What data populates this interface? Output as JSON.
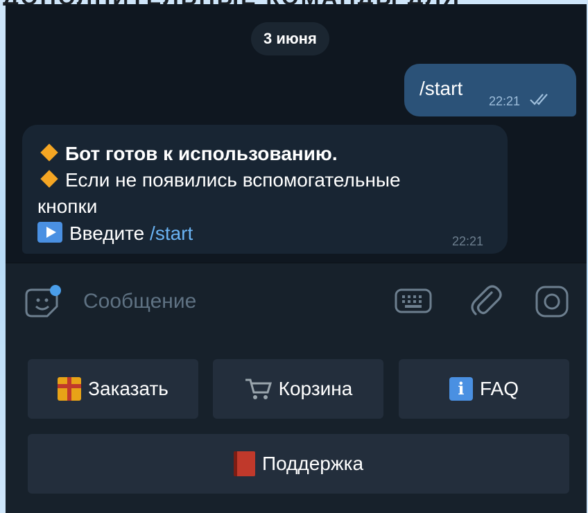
{
  "top_banner": "ДОПОЛНИТЕЛЬНЫЕ КОМАНДЫ ДЛЯ",
  "chat": {
    "date_separator": "3 июня",
    "outgoing": {
      "text": "/start",
      "time": "22:21",
      "status": "read"
    },
    "incoming": {
      "line1": "Бот готов к использованию.",
      "line2": "Если не появились вспомогательные",
      "line3": "кнопки",
      "line4_prefix": "Введите ",
      "line4_link": "/start",
      "time": "22:21"
    }
  },
  "input_bar": {
    "placeholder": "Сообщение",
    "icons": [
      "sticker-icon",
      "keyboard-icon",
      "paperclip-icon",
      "camera-icon"
    ]
  },
  "bot_keyboard": {
    "buttons": [
      {
        "emoji": "gift-icon",
        "label": "Заказать"
      },
      {
        "emoji": "cart-icon",
        "label": "Корзина"
      },
      {
        "emoji": "info-icon",
        "label": "FAQ"
      },
      {
        "emoji": "book-icon",
        "label": "Поддержка"
      }
    ]
  },
  "colors": {
    "accent": "#6ab3f3",
    "outgoing_bubble": "#2b5278",
    "incoming_bubble": "#182533",
    "panel": "#17212b",
    "diamond": "#f5a623"
  }
}
